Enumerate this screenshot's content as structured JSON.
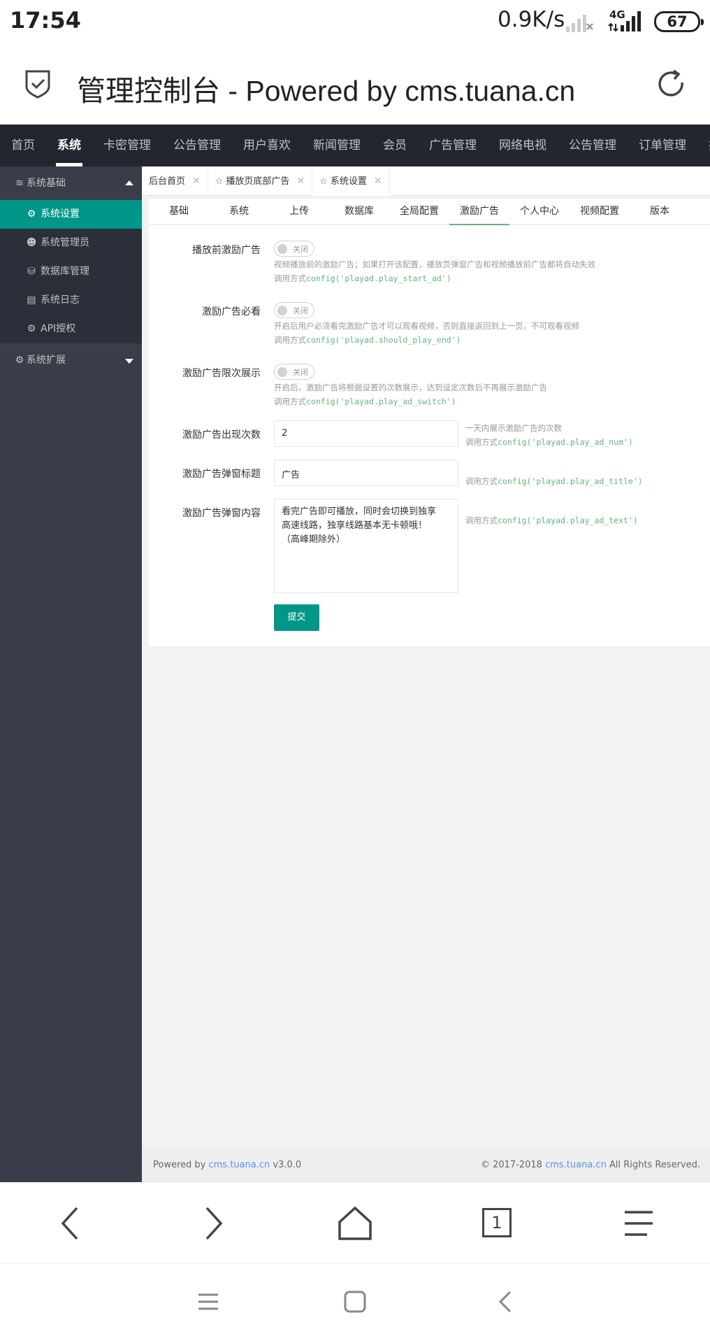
{
  "status_bar": {
    "time": "17:54",
    "net_speed": "0.9K/s",
    "network_type": "4G",
    "battery": "67"
  },
  "browser": {
    "title": "管理控制台 - Powered by cms.tuana.cn",
    "tab_count": "1"
  },
  "top_nav": [
    "首页",
    "系统",
    "卡密管理",
    "公告管理",
    "用户喜欢",
    "新闻管理",
    "会员",
    "广告管理",
    "网络电视",
    "公告管理",
    "订单管理",
    "插件"
  ],
  "sidebar": {
    "group1": "系统基础",
    "items": [
      "系统设置",
      "系统管理员",
      "数据库管理",
      "系统日志",
      "API授权"
    ],
    "group2": "系统扩展"
  },
  "page_tabs": [
    "后台首页",
    "播放页底部广告",
    "系统设置"
  ],
  "sub_tabs": [
    "基础",
    "系统",
    "上传",
    "数据库",
    "全局配置",
    "激励广告",
    "个人中心",
    "视频配置",
    "版本"
  ],
  "form": {
    "f1": {
      "label": "播放前激励广告",
      "switch": "关闭",
      "hint1": "视频播放前的激励广告；如果打开该配置，播放页弹窗广告和视频播放前广告都将自动失效",
      "hint2_prefix": "调用方式",
      "hint2_code": "config('playad.play_start_ad')"
    },
    "f2": {
      "label": "激励广告必看",
      "switch": "关闭",
      "hint1": "开启后用户必须看完激励广告才可以观看视频，否则直接返回到上一页，不可观看视频",
      "hint2_prefix": "调用方式",
      "hint2_code": "config('playad.should_play_end')"
    },
    "f3": {
      "label": "激励广告限次展示",
      "switch": "关闭",
      "hint1": "开启后，激励广告将根据设置的次数展示，达到设定次数后不再展示激励广告",
      "hint2_prefix": "调用方式",
      "hint2_code": "config('playad.play_ad_switch')"
    },
    "f4": {
      "label": "激励广告出现次数",
      "value": "2",
      "hint1": "一天内展示激励广告的次数",
      "hint2_prefix": "调用方式",
      "hint2_code": "config('playad.play_ad_num')"
    },
    "f5": {
      "label": "激励广告弹窗标题",
      "value": "广告",
      "hint2_prefix": "调用方式",
      "hint2_code": "config('playad.play_ad_title')"
    },
    "f6": {
      "label": "激励广告弹窗内容",
      "value": "看完广告即可播放，同时会切换到独享\n高速线路，独享线路基本无卡顿哦！\n（高峰期除外）",
      "hint2_prefix": "调用方式",
      "hint2_code": "config('playad.play_ad_text')"
    },
    "submit": "提交"
  },
  "footer": {
    "left_prefix": "Powered by ",
    "left_link": "cms.tuana.cn",
    "left_suffix": " v3.0.0",
    "right_prefix": "© 2017-2018 ",
    "right_link": "cms.tuana.cn",
    "right_suffix": " All Rights Reserved."
  },
  "colors": {
    "nav_bg": "#23262e",
    "sidebar_bg": "#393d49",
    "accent": "#009688",
    "code": "#5fb878",
    "link": "#5b8ee8"
  }
}
